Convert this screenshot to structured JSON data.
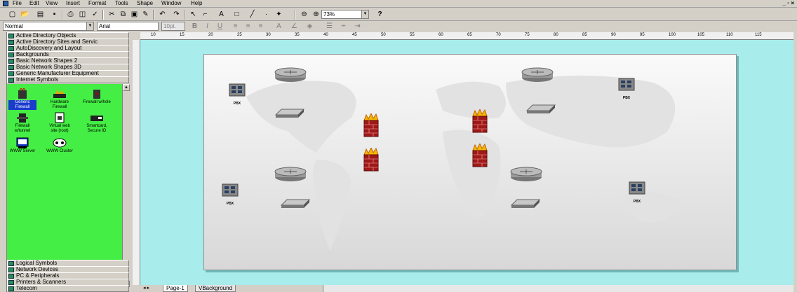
{
  "menu": [
    "File",
    "Edit",
    "View",
    "Insert",
    "Format",
    "Tools",
    "Shape",
    "Window",
    "Help"
  ],
  "window_controls": "_ ▫ ×",
  "toolbar": {
    "zoom": "73%",
    "help": "?"
  },
  "format_bar": {
    "style": "Normal",
    "font": "Arial",
    "size": "10pt."
  },
  "stencils_top": [
    "Active Directory Objects",
    "Active Directory Sites and Servic",
    "AutoDiscovery and Layout",
    "Backgrounds",
    "Basic Network Shapes 2",
    "Basic Network Shapes 3D",
    "Generic Manufacturer Equipment",
    "Internet Symbols"
  ],
  "stencil_shapes": [
    {
      "label": "Generic Firewall",
      "icon": "firewall-icon"
    },
    {
      "label": "Hardware Firewall",
      "icon": "hardware-firewall-icon"
    },
    {
      "label": "Firewall w/hole",
      "icon": "firewall-hole-icon"
    },
    {
      "label": "Firewall w/tunnel",
      "icon": "firewall-tunnel-icon"
    },
    {
      "label": "Virtual web site (root)",
      "icon": "web-site-icon"
    },
    {
      "label": "Smartcard, Secure ID",
      "icon": "smartcard-icon"
    },
    {
      "label": "WWW Server",
      "icon": "www-server-icon"
    },
    {
      "label": "WWW Cluster",
      "icon": "www-cluster-icon"
    }
  ],
  "stencils_bottom": [
    "Logical Symbols",
    "Network Devices",
    "PC & Peripherals",
    "Printers & Scanners",
    "Telecom"
  ],
  "page_tabs": [
    "Page-1",
    "VBackground"
  ],
  "ruler_ticks": [
    "10",
    "15",
    "20",
    "25",
    "30",
    "35",
    "40",
    "45",
    "50",
    "55",
    "60",
    "65",
    "70",
    "75",
    "80",
    "85",
    "90",
    "95",
    "100",
    "105",
    "110",
    "115"
  ],
  "pbx_label": "PBX"
}
